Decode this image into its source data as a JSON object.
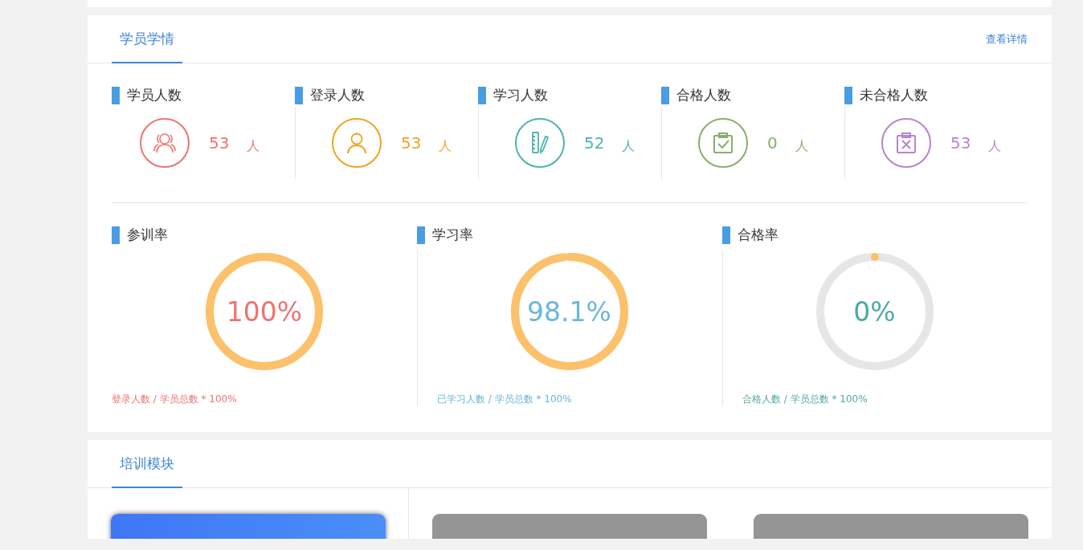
{
  "learning_panel": {
    "tabs": [
      {
        "label": "学员学情",
        "selected": true
      }
    ],
    "details_link": "查看详情",
    "stats": [
      {
        "kind": "students",
        "label": "学员人数",
        "value": "53",
        "unit": "人",
        "color": "#ee7373"
      },
      {
        "kind": "login",
        "label": "登录人数",
        "value": "53",
        "unit": "人",
        "color": "#f0a41f"
      },
      {
        "kind": "study",
        "label": "学习人数",
        "value": "52",
        "unit": "人",
        "color": "#4db3ae"
      },
      {
        "kind": "pass",
        "label": "合格人数",
        "value": "0",
        "unit": "人",
        "color": "#8aae6a"
      },
      {
        "kind": "fail",
        "label": "未合格人数",
        "value": "53",
        "unit": "人",
        "color": "#b784cf"
      }
    ],
    "rates": [
      {
        "label": "参训率",
        "percent": "100%",
        "level": 1,
        "formula": "登录人数 / 学员总数 * 100%",
        "color": "#ee7373"
      },
      {
        "label": "学习率",
        "percent": "98.1%",
        "level": 0.981,
        "formula": "已学习人数 / 学员总数 * 100%",
        "color": "#6bb8d8"
      },
      {
        "label": "合格率",
        "percent": "0%",
        "level": 0,
        "formula": "合格人数 / 学员总数 * 100%",
        "color": "#4fa9a3"
      }
    ]
  },
  "training_panel": {
    "tabs": [
      {
        "label": "培训模块",
        "selected": true
      }
    ],
    "modules": [
      {
        "active": true
      },
      {
        "active": false
      },
      {
        "active": false
      }
    ]
  }
}
